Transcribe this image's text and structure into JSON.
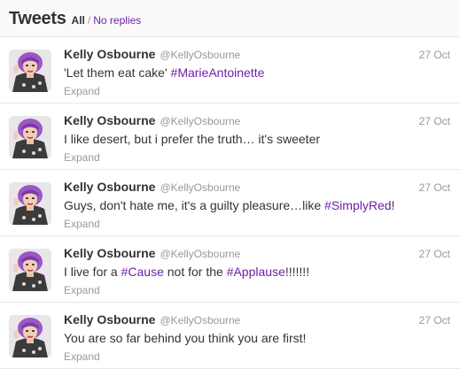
{
  "header": {
    "title": "Tweets",
    "filter_all": "All",
    "filter_separator": "/",
    "filter_no_replies": "No replies"
  },
  "colors": {
    "accent": "#6e1fa8",
    "muted": "#999999",
    "text": "#333333"
  },
  "tweets": [
    {
      "fullname": "Kelly Osbourne",
      "username": "@KellyOsbourne",
      "time": "27 Oct",
      "parts": [
        {
          "text": "'Let them eat cake' ",
          "hashtag": false
        },
        {
          "text": "#MarieAntoinette",
          "hashtag": true
        }
      ],
      "expand": "Expand"
    },
    {
      "fullname": "Kelly Osbourne",
      "username": "@KellyOsbourne",
      "time": "27 Oct",
      "parts": [
        {
          "text": "I like desert, but i prefer the truth… it's sweeter",
          "hashtag": false
        }
      ],
      "expand": "Expand"
    },
    {
      "fullname": "Kelly Osbourne",
      "username": "@KellyOsbourne",
      "time": "27 Oct",
      "parts": [
        {
          "text": "Guys, don't hate me, it's a guilty pleasure…like ",
          "hashtag": false
        },
        {
          "text": "#SimplyRed",
          "hashtag": true
        },
        {
          "text": "!",
          "hashtag": false
        }
      ],
      "expand": "Expand"
    },
    {
      "fullname": "Kelly Osbourne",
      "username": "@KellyOsbourne",
      "time": "27 Oct",
      "parts": [
        {
          "text": "I live for a ",
          "hashtag": false
        },
        {
          "text": "#Cause",
          "hashtag": true
        },
        {
          "text": " not for the ",
          "hashtag": false
        },
        {
          "text": "#Applause",
          "hashtag": true
        },
        {
          "text": "!!!!!!!",
          "hashtag": false
        }
      ],
      "expand": "Expand"
    },
    {
      "fullname": "Kelly Osbourne",
      "username": "@KellyOsbourne",
      "time": "27 Oct",
      "parts": [
        {
          "text": "You are so far behind you think you are first!",
          "hashtag": false
        }
      ],
      "expand": "Expand"
    }
  ]
}
